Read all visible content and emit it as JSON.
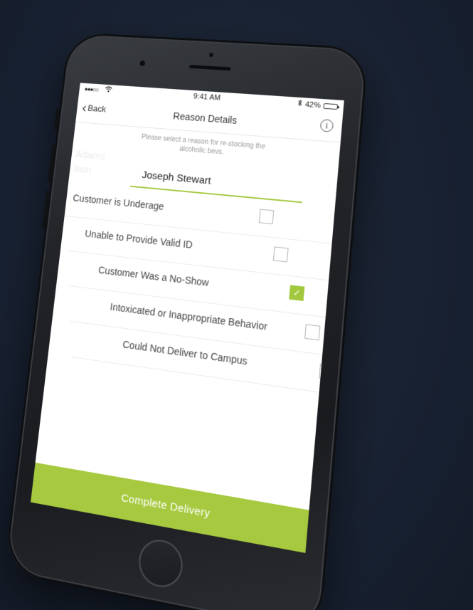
{
  "status_bar": {
    "signal": "●●●○○",
    "wifi_icon": "wifi-icon",
    "time": "9:41 AM",
    "bluetooth_icon": "bluetooth-icon",
    "battery_percent": "42%",
    "battery_level": 0.42
  },
  "nav": {
    "back_label": "Back",
    "title": "Reason Details",
    "info_glyph": "i"
  },
  "instructions": "Please select a reason for re-stocking the alcoholic bevs.",
  "customers": {
    "faded": [
      "Adams",
      "lson"
    ],
    "current": "Joseph Stewart"
  },
  "reasons": [
    {
      "label": "Customer is Underage",
      "checked": false
    },
    {
      "label": "Unable to Provide Valid ID",
      "checked": false
    },
    {
      "label": "Customer Was a No-Show",
      "checked": true
    },
    {
      "label": "Intoxicated or Inappropriate Behavior",
      "checked": false
    },
    {
      "label": "Could Not Deliver to Campus",
      "checked": false
    }
  ],
  "complete_button": "Complete Delivery",
  "colors": {
    "accent": "#a6c940",
    "background": "#192130"
  }
}
